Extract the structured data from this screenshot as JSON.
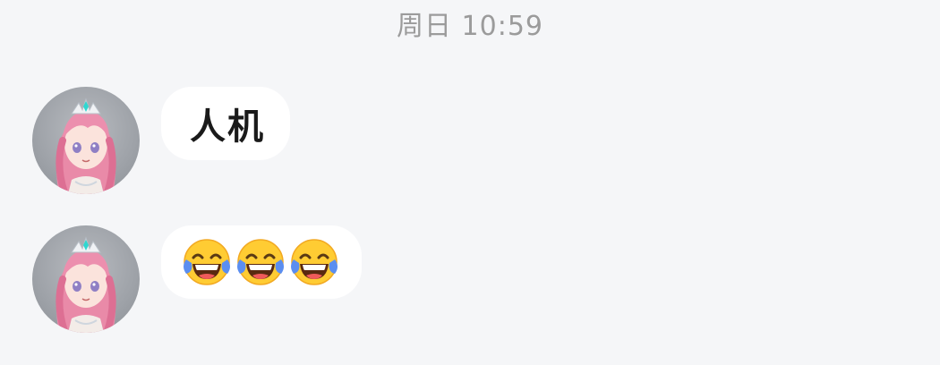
{
  "header": {
    "timestamp": "周日 10:59"
  },
  "messages": [
    {
      "sender_avatar": "anime-girl-avatar",
      "type": "text",
      "text": "人机"
    },
    {
      "sender_avatar": "anime-girl-avatar",
      "type": "emoji",
      "emojis": [
        "face-with-tears-of-joy",
        "face-with-tears-of-joy",
        "face-with-tears-of-joy"
      ]
    }
  ],
  "colors": {
    "background": "#f5f6f8",
    "bubble": "#ffffff",
    "timestamp": "#9b9b9b",
    "text": "#1a1a1a"
  }
}
